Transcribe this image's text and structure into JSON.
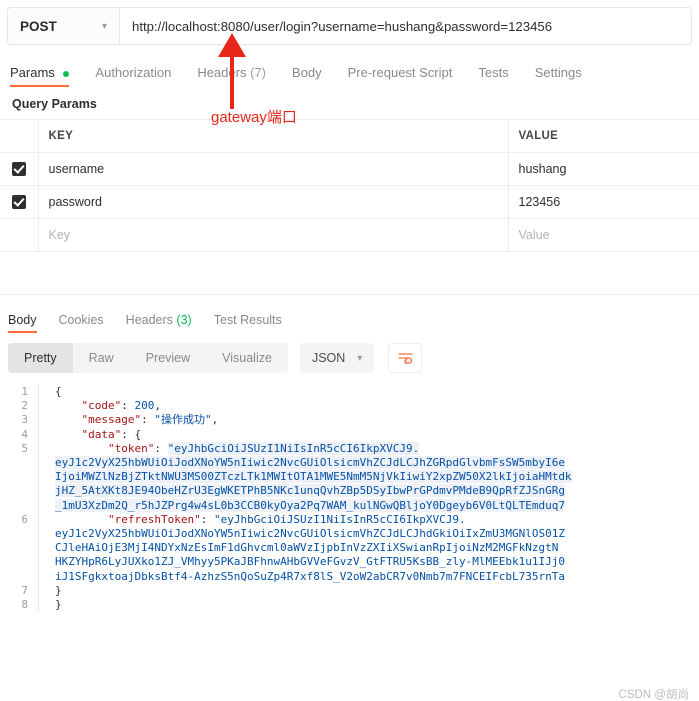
{
  "request": {
    "method": "POST",
    "method_chevron": "chevron-down-icon",
    "url": "http://localhost:8080/user/login?username=hushang&password=123456",
    "url_placeholder": "Enter request URL",
    "tabs": [
      {
        "label": "Params",
        "badge": "dot",
        "active": true
      },
      {
        "label": "Authorization",
        "badge": "",
        "active": false
      },
      {
        "label": "Headers",
        "badge": "(7)",
        "active": false
      },
      {
        "label": "Body",
        "badge": "",
        "active": false
      },
      {
        "label": "Pre-request Script",
        "badge": "",
        "active": false
      },
      {
        "label": "Tests",
        "badge": "",
        "active": false
      },
      {
        "label": "Settings",
        "badge": "",
        "active": false
      }
    ]
  },
  "query_params": {
    "title": "Query Params",
    "headers": [
      "KEY",
      "VALUE"
    ],
    "rows": [
      {
        "checked": true,
        "key": "username",
        "value": "hushang",
        "placeholder": false
      },
      {
        "checked": true,
        "key": "password",
        "value": "123456",
        "placeholder": false
      },
      {
        "checked": false,
        "key": "Key",
        "value": "Value",
        "placeholder": true
      }
    ]
  },
  "response": {
    "tabs": [
      {
        "label": "Body",
        "badge": "",
        "active": true
      },
      {
        "label": "Cookies",
        "badge": "",
        "active": false
      },
      {
        "label": "Headers",
        "badge": "(3)",
        "active": false
      },
      {
        "label": "Test Results",
        "badge": "",
        "active": false
      }
    ],
    "view_modes": [
      {
        "label": "Pretty",
        "active": true
      },
      {
        "label": "Raw",
        "active": false
      },
      {
        "label": "Preview",
        "active": false
      },
      {
        "label": "Visualize",
        "active": false
      }
    ],
    "format": "JSON",
    "format_chevron": "chevron-down-icon",
    "wrap_icon": "word-wrap-icon"
  },
  "body_json": {
    "code_key": "\"code\"",
    "code_value": "200",
    "message_key": "\"message\"",
    "message_value": "\"操作成功\"",
    "data_key": "\"data\"",
    "token_key": "\"token\"",
    "token_lines": [
      "\"eyJhbGciOiJSUzI1NiIsInR5cCI6IkpXVCJ9.",
      "eyJ1c2VyX25hbWUiOiJodXNoYW5nIiwic2NvcGUiOlsicmVhZCJdLCJhZGRpdGlvbmFsSW5mbyI6e",
      "IjoiMWZlNzBjZTktNWU3MS00ZTczLTk1MWItOTA1MWE5NmM5NjVkIiwiY2xpZW50X2lkIjoiaHMtdk",
      "jHZ_5AtXKt8JE94ObeHZrU3EgWKETPhB5NKc1unqQvhZBp5DSyIbwPrGPdmvPMdeB9QpRfZJSnGRg",
      "_1mU3XzDm2Q_r5hJZPrg4w4sL0b3CCB0kyOya2Pq7WAM_kulNGwQBljoY0Dgeyb6V0LtQLTEmduq7"
    ],
    "refresh_key": "\"refreshToken\"",
    "refresh_lines": [
      "\"eyJhbGciOiJSUzI1NiIsInR5cCI6IkpXVCJ9.",
      "eyJ1c2VyX25hbWUiOiJodXNoYW5nIiwic2NvcGUiOlsicmVhZCJdLCJhdGkiOiIxZmU3MGNlOS01Z",
      "CJleHAiOjE3MjI4NDYxNzEsImF1dGhvcml0aWVzIjpbInVzZXIiXSwianRpIjoiNzM2MGFkNzgtN",
      "HKZYHpR6LyJUXko1ZJ_VMhyy5PKaJBFhnwAHbGVVeFGvzV_GtFTRU5KsBB_zly-MlMEEbk1u1IJj0",
      "iJ1SFgkxtoajDbksBtf4-AzhzS5nQoSuZp4R7xf8lS_V2oW2abCR7v0Nmb7m7FNCEIFcbL735rnTa"
    ],
    "line_numbers": [
      "1",
      "2",
      "3",
      "4",
      "5",
      "6",
      "7",
      "8"
    ],
    "brace_open": "{",
    "brace_close": "}",
    "inner_close": "}",
    "comma": ",",
    "colon": ":"
  },
  "annotation": {
    "text": "gateway端口",
    "color": "#e8271b"
  },
  "watermark": "CSDN @胡尚"
}
